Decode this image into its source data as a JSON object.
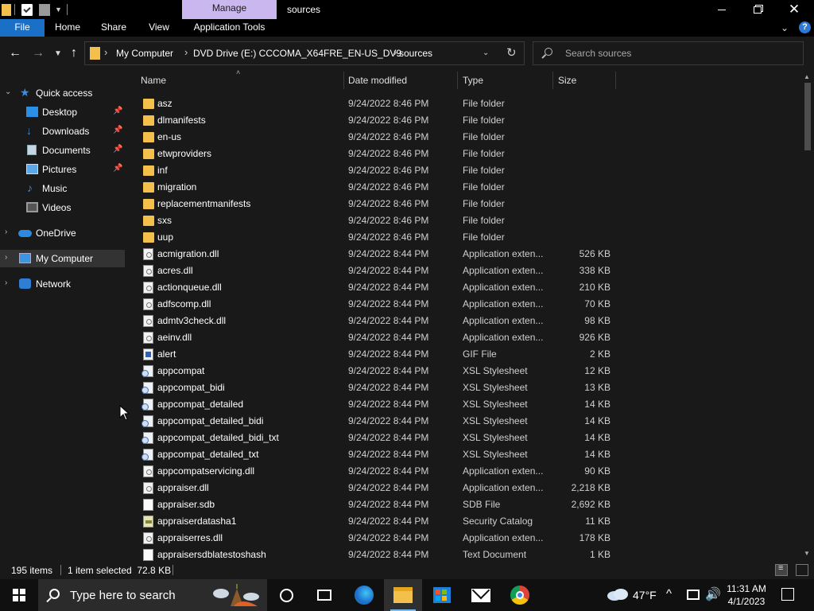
{
  "titlebar": {
    "manage_tab": "Manage",
    "title": "sources"
  },
  "ribbon": {
    "file": "File",
    "home": "Home",
    "share": "Share",
    "view": "View",
    "app_tools": "Application Tools",
    "help": "?"
  },
  "address": {
    "crumbs": [
      "My Computer",
      "DVD Drive (E:) CCCOMA_X64FRE_EN-US_DV9",
      "sources"
    ]
  },
  "search": {
    "placeholder": "Search sources"
  },
  "nav": {
    "items": [
      {
        "label": "Quick access",
        "icon": "star-icon",
        "pinned": false,
        "expanded": true
      },
      {
        "label": "Desktop",
        "icon": "desktop-icon",
        "pinned": true
      },
      {
        "label": "Downloads",
        "icon": "download-icon",
        "pinned": true
      },
      {
        "label": "Documents",
        "icon": "documents-icon",
        "pinned": true
      },
      {
        "label": "Pictures",
        "icon": "pictures-icon",
        "pinned": true
      },
      {
        "label": "Music",
        "icon": "music-icon",
        "pinned": false
      },
      {
        "label": "Videos",
        "icon": "videos-icon",
        "pinned": false
      },
      {
        "label": "OneDrive",
        "icon": "onedrive-icon",
        "pinned": false
      },
      {
        "label": "My Computer",
        "icon": "computer-icon",
        "pinned": false,
        "selected": true
      },
      {
        "label": "Network",
        "icon": "network-icon",
        "pinned": false
      }
    ]
  },
  "columns": {
    "name": "Name",
    "date": "Date modified",
    "type": "Type",
    "size": "Size"
  },
  "files": [
    {
      "name": "asz",
      "date": "9/24/2022 8:46 PM",
      "type": "File folder",
      "size": "",
      "icon": "folder"
    },
    {
      "name": "dlmanifests",
      "date": "9/24/2022 8:46 PM",
      "type": "File folder",
      "size": "",
      "icon": "folder"
    },
    {
      "name": "en-us",
      "date": "9/24/2022 8:46 PM",
      "type": "File folder",
      "size": "",
      "icon": "folder"
    },
    {
      "name": "etwproviders",
      "date": "9/24/2022 8:46 PM",
      "type": "File folder",
      "size": "",
      "icon": "folder"
    },
    {
      "name": "inf",
      "date": "9/24/2022 8:46 PM",
      "type": "File folder",
      "size": "",
      "icon": "folder"
    },
    {
      "name": "migration",
      "date": "9/24/2022 8:46 PM",
      "type": "File folder",
      "size": "",
      "icon": "folder"
    },
    {
      "name": "replacementmanifests",
      "date": "9/24/2022 8:46 PM",
      "type": "File folder",
      "size": "",
      "icon": "folder"
    },
    {
      "name": "sxs",
      "date": "9/24/2022 8:46 PM",
      "type": "File folder",
      "size": "",
      "icon": "folder"
    },
    {
      "name": "uup",
      "date": "9/24/2022 8:46 PM",
      "type": "File folder",
      "size": "",
      "icon": "folder"
    },
    {
      "name": "acmigration.dll",
      "date": "9/24/2022 8:44 PM",
      "type": "Application exten...",
      "size": "526 KB",
      "icon": "dll"
    },
    {
      "name": "acres.dll",
      "date": "9/24/2022 8:44 PM",
      "type": "Application exten...",
      "size": "338 KB",
      "icon": "dll"
    },
    {
      "name": "actionqueue.dll",
      "date": "9/24/2022 8:44 PM",
      "type": "Application exten...",
      "size": "210 KB",
      "icon": "dll"
    },
    {
      "name": "adfscomp.dll",
      "date": "9/24/2022 8:44 PM",
      "type": "Application exten...",
      "size": "70 KB",
      "icon": "dll"
    },
    {
      "name": "admtv3check.dll",
      "date": "9/24/2022 8:44 PM",
      "type": "Application exten...",
      "size": "98 KB",
      "icon": "dll"
    },
    {
      "name": "aeinv.dll",
      "date": "9/24/2022 8:44 PM",
      "type": "Application exten...",
      "size": "926 KB",
      "icon": "dll"
    },
    {
      "name": "alert",
      "date": "9/24/2022 8:44 PM",
      "type": "GIF File",
      "size": "2 KB",
      "icon": "gif"
    },
    {
      "name": "appcompat",
      "date": "9/24/2022 8:44 PM",
      "type": "XSL Stylesheet",
      "size": "12 KB",
      "icon": "xsl"
    },
    {
      "name": "appcompat_bidi",
      "date": "9/24/2022 8:44 PM",
      "type": "XSL Stylesheet",
      "size": "13 KB",
      "icon": "xsl"
    },
    {
      "name": "appcompat_detailed",
      "date": "9/24/2022 8:44 PM",
      "type": "XSL Stylesheet",
      "size": "14 KB",
      "icon": "xsl"
    },
    {
      "name": "appcompat_detailed_bidi",
      "date": "9/24/2022 8:44 PM",
      "type": "XSL Stylesheet",
      "size": "14 KB",
      "icon": "xsl"
    },
    {
      "name": "appcompat_detailed_bidi_txt",
      "date": "9/24/2022 8:44 PM",
      "type": "XSL Stylesheet",
      "size": "14 KB",
      "icon": "xsl"
    },
    {
      "name": "appcompat_detailed_txt",
      "date": "9/24/2022 8:44 PM",
      "type": "XSL Stylesheet",
      "size": "14 KB",
      "icon": "xsl"
    },
    {
      "name": "appcompatservicing.dll",
      "date": "9/24/2022 8:44 PM",
      "type": "Application exten...",
      "size": "90 KB",
      "icon": "dll"
    },
    {
      "name": "appraiser.dll",
      "date": "9/24/2022 8:44 PM",
      "type": "Application exten...",
      "size": "2,218 KB",
      "icon": "dll"
    },
    {
      "name": "appraiser.sdb",
      "date": "9/24/2022 8:44 PM",
      "type": "SDB File",
      "size": "2,692 KB",
      "icon": "sdb"
    },
    {
      "name": "appraiserdatasha1",
      "date": "9/24/2022 8:44 PM",
      "type": "Security Catalog",
      "size": "11 KB",
      "icon": "cat"
    },
    {
      "name": "appraiserres.dll",
      "date": "9/24/2022 8:44 PM",
      "type": "Application exten...",
      "size": "178 KB",
      "icon": "dll"
    },
    {
      "name": "appraisersdblatestoshash",
      "date": "9/24/2022 8:44 PM",
      "type": "Text Document",
      "size": "1 KB",
      "icon": "txt"
    }
  ],
  "status": {
    "item_count": "195 items",
    "selection": "1 item selected  72.8 KB"
  },
  "taskbar": {
    "search_placeholder": "Type here to search",
    "weather_temp": "47°F",
    "time": "11:31 AM",
    "date": "4/1/2023"
  }
}
